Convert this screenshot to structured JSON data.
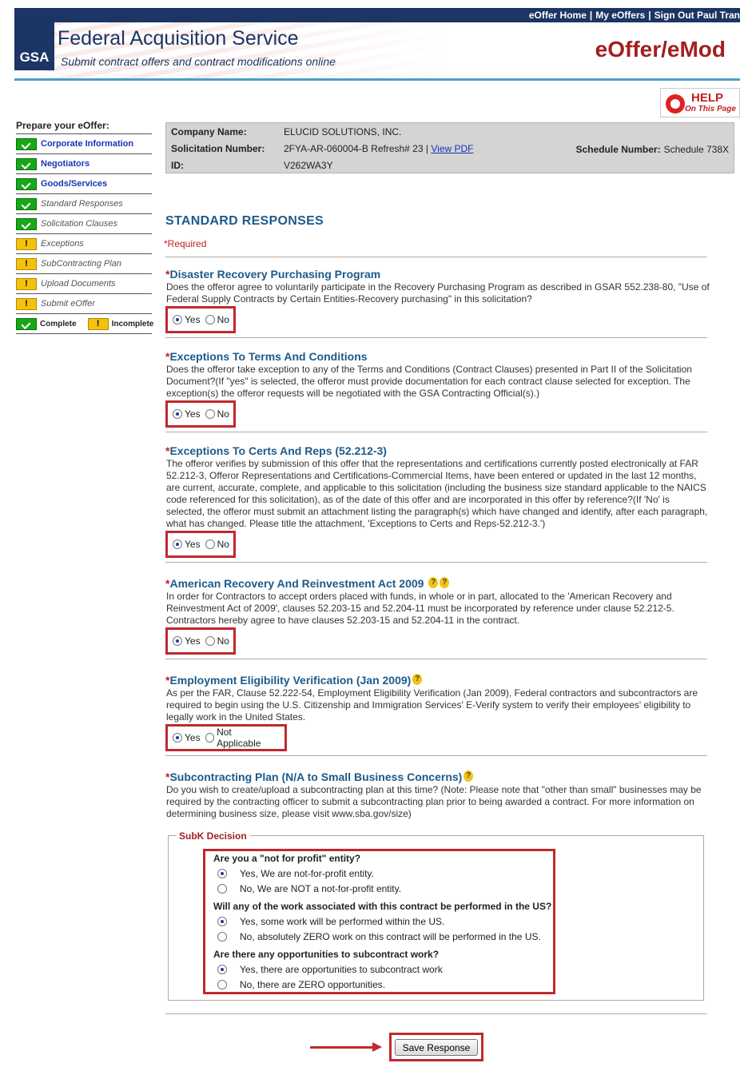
{
  "topbar": {
    "links": [
      "eOffer Home",
      "My eOffers",
      "Sign Out Paul Tran"
    ]
  },
  "header": {
    "logo_text": "GSA",
    "org_title": "Federal Acquisition Service",
    "org_subtitle": "Submit contract offers and contract modifications online",
    "app_title": "eOffer/eMod",
    "help_big": "HELP",
    "help_small": "On This Page"
  },
  "sidebar": {
    "heading": "Prepare your eOffer:",
    "items": [
      {
        "label": "Corporate Information",
        "status": "complete",
        "link": true
      },
      {
        "label": "Negotiators",
        "status": "complete",
        "link": true
      },
      {
        "label": "Goods/Services",
        "status": "complete",
        "link": true
      },
      {
        "label": "Standard Responses",
        "status": "complete",
        "link": false
      },
      {
        "label": "Solicitation Clauses",
        "status": "complete",
        "link": false
      },
      {
        "label": "Exceptions",
        "status": "incomplete",
        "link": false
      },
      {
        "label": "SubContracting Plan",
        "status": "incomplete",
        "link": false
      },
      {
        "label": "Upload Documents",
        "status": "incomplete",
        "link": false
      },
      {
        "label": "Submit eOffer",
        "status": "incomplete",
        "link": false
      }
    ],
    "legend_complete": "Complete",
    "legend_incomplete": "Incomplete"
  },
  "info": {
    "company_label": "Company Name:",
    "company_value": "ELUCID SOLUTIONS, INC.",
    "solicitation_label": "Solicitation Number:",
    "solicitation_value": "2FYA-AR-060004-B Refresh# 23 |",
    "view_pdf": "View PDF",
    "id_label": "ID:",
    "id_value": "V262WA3Y",
    "schedule_label": "Schedule Number:",
    "schedule_value": "Schedule 738X"
  },
  "main": {
    "title": "STANDARD RESPONSES",
    "required_note": "*Required",
    "sections": [
      {
        "title": "Disaster Recovery Purchasing Program",
        "desc": "Does the offeror agree to voluntarily participate in the Recovery Purchasing Program as described in GSAR 552.238-80, \"Use of Federal Supply Contracts by Certain Entities-Recovery purchasing\" in this solicitation?",
        "options": [
          "Yes",
          "No"
        ],
        "selected": "Yes"
      },
      {
        "title": "Exceptions To Terms And Conditions",
        "desc": "Does the offeror take exception to any of the Terms and Conditions (Contract Clauses) presented in Part II of the Solicitation Document?(If \"yes\" is selected, the offeror must provide documentation for each contract clause selected for exception. The exception(s) the offeror requests will be negotiated with the GSA Contracting Official(s).)",
        "options": [
          "Yes",
          "No"
        ],
        "selected": "Yes"
      },
      {
        "title": "Exceptions To Certs And Reps (52.212-3)",
        "desc": "The offeror verifies by submission of this offer that the representations and certifications currently posted electronically at FAR 52.212-3, Offeror Representations and Certifications-Commercial Items, have been entered or updated in the last 12 months, are current, accurate, complete, and applicable to this solicitation (including the business size standard applicable to the NAICS code referenced for this solicitation), as of the date of this offer and are incorporated in this offer by reference?(If 'No' is selected, the offeror must submit an attachment listing the paragraph(s) which have changed and identify, after each paragraph, what has changed. Please title the attachment, 'Exceptions to Certs and Reps-52.212-3.')",
        "options": [
          "Yes",
          "No"
        ],
        "selected": "Yes"
      },
      {
        "title": "American Recovery And Reinvestment Act 2009",
        "desc": "In order for Contractors to accept orders placed with funds, in whole or in part, allocated to the 'American Recovery and Reinvestment Act of 2009', clauses 52.203-15 and 52.204-11 must be incorporated by reference under clause 52.212-5. Contractors hereby agree to have clauses 52.203-15 and 52.204-11 in the contract.",
        "options": [
          "Yes",
          "No"
        ],
        "selected": "Yes"
      },
      {
        "title": "Employment Eligibility Verification (Jan 2009)",
        "desc": "As per the FAR, Clause 52.222-54, Employment Eligibility Verification (Jan 2009), Federal contractors and subcontractors are required to begin using the U.S. Citizenship and Immigration Services' E-Verify system to verify their employees' eligibility to legally work in the United States.",
        "options": [
          "Yes",
          "Not Applicable"
        ],
        "selected": "Yes"
      },
      {
        "title": "Subcontracting Plan (N/A to Small Business Concerns)",
        "desc": "Do you wish to create/upload a subcontracting plan at this time? (Note: Please note that \"other than small\" businesses may be required by the contracting officer to submit a subcontracting plan prior to being awarded a contract. For more information on determining business size, please visit www.sba.gov/size)"
      }
    ],
    "subk": {
      "legend": "SubK Decision",
      "questions": [
        {
          "q": "Are you a \"not for profit\" entity?",
          "options": [
            "Yes, We are not-for-profit entity.",
            "No, We are NOT a not-for-profit entity."
          ],
          "selected": 0
        },
        {
          "q": "Will any of the work associated with this contract be performed in the US?",
          "options": [
            "Yes, some work will be performed within the US.",
            "No, absolutely ZERO work on this contract will be performed in the US."
          ],
          "selected": 0
        },
        {
          "q": "Are there any opportunities to subcontract work?",
          "options": [
            "Yes, there are opportunities to subcontract work",
            "No, there are ZERO opportunities."
          ],
          "selected": 0
        }
      ]
    },
    "save_label": "Save Response"
  }
}
